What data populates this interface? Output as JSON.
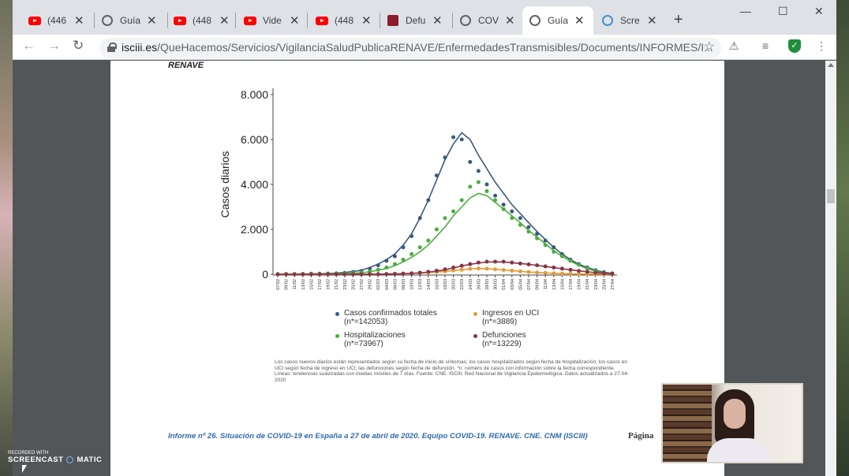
{
  "browser": {
    "tabs": [
      {
        "title": "(446",
        "icon": "youtube"
      },
      {
        "title": "Guía",
        "icon": "globe"
      },
      {
        "title": "(448",
        "icon": "youtube"
      },
      {
        "title": "Vide",
        "icon": "youtube"
      },
      {
        "title": "(448",
        "icon": "youtube"
      },
      {
        "title": "Defu",
        "icon": "defunciones"
      },
      {
        "title": "COVI",
        "icon": "globe"
      },
      {
        "title": "Guía",
        "icon": "globe"
      },
      {
        "title": "Scre",
        "icon": "screencast"
      }
    ],
    "active_tab_index": 7,
    "url_host": "isciii.es",
    "url_path": "/QueHacemos/Servicios/VigilanciaSaludPublicaRENAVE/EnfermedadesTransmisibles/Documents/INFORMES/I..."
  },
  "document": {
    "header_fragment": "RENAVE",
    "caption": "Los casos nuevos diarios están representados según su fecha de inicio de síntomas; los casos hospitalizados según fecha de hospitalización; los casos en UCI según fecha de ingreso en UCI; las defunciones según fecha de defunción. *n: número de casos con información sobre la fecha correspondiente. Líneas: tendencias suavizadas con medias móviles de 7 días. Fuente: CNE. ISCIII. Red Nacional de Vigilancia Epidemiológica. Datos actualizados a 27-04-2020",
    "footer": "Informe  nº 26.  Situación de COVID-19 en España a 27  de abril de 2020. Equipo COVID-19. RENAVE. CNE. CNM (ISCIII)",
    "page_label": "Página"
  },
  "chart_data": {
    "type": "scatter",
    "ylabel": "Casos diarios",
    "ylim": [
      0,
      8000
    ],
    "yticks": [
      "8.000",
      "6.000",
      "4.000",
      "2.000",
      "0"
    ],
    "yticks_values": [
      8000,
      6000,
      4000,
      2000,
      0
    ],
    "x_labels": [
      "07/02",
      "09/02",
      "11/02",
      "13/02",
      "15/02",
      "17/02",
      "19/02",
      "21/02",
      "23/02",
      "25/02",
      "27/02",
      "29/02",
      "02/03",
      "04/03",
      "06/03",
      "08/03",
      "10/03",
      "12/03",
      "14/03",
      "16/03",
      "18/03",
      "20/03",
      "22/03",
      "24/03",
      "26/03",
      "28/03",
      "30/03",
      "01/04",
      "03/04",
      "05/04",
      "07/04",
      "09/04",
      "11/04",
      "13/04",
      "15/04",
      "17/04",
      "19/04",
      "21/04",
      "23/04",
      "25/04",
      "27/04"
    ],
    "grid": false,
    "legend_position": "bottom",
    "series": [
      {
        "name": "Casos confirmados totales",
        "n_label": "(n*=142053)",
        "color": "#3b5a7f",
        "values": [
          5,
          10,
          10,
          15,
          20,
          25,
          30,
          40,
          60,
          100,
          150,
          250,
          400,
          600,
          800,
          1200,
          1700,
          2500,
          3300,
          4400,
          5200,
          6100,
          6000,
          5000,
          4600,
          4000,
          3500,
          3100,
          2800,
          2500,
          2100,
          1800,
          1500,
          1200,
          900,
          650,
          450,
          300,
          180,
          90,
          40
        ]
      },
      {
        "name": "Hospitalizaciones",
        "n_label": "(n*=73967)",
        "color": "#4aae3c",
        "values": [
          3,
          5,
          5,
          8,
          10,
          12,
          15,
          20,
          30,
          50,
          80,
          120,
          200,
          300,
          450,
          650,
          900,
          1200,
          1500,
          2000,
          2500,
          2800,
          3300,
          3900,
          4100,
          3700,
          3300,
          2900,
          2500,
          2200,
          1900,
          1600,
          1300,
          1000,
          800,
          600,
          420,
          260,
          140,
          60,
          20
        ]
      },
      {
        "name": "Ingresos en UCI",
        "n_label": "(n*=3889)",
        "color": "#e39b3b",
        "values": [
          0,
          0,
          0,
          0,
          0,
          0,
          0,
          0,
          0,
          2,
          4,
          6,
          10,
          15,
          20,
          30,
          45,
          60,
          80,
          100,
          130,
          170,
          200,
          240,
          260,
          250,
          220,
          190,
          160,
          130,
          100,
          80,
          60,
          40,
          30,
          20,
          12,
          8,
          4,
          2,
          0
        ]
      },
      {
        "name": "Defunciones",
        "n_label": "(n*=13229)",
        "color": "#8b3345",
        "values": [
          0,
          0,
          0,
          0,
          0,
          0,
          0,
          0,
          0,
          1,
          2,
          3,
          5,
          10,
          15,
          25,
          40,
          70,
          110,
          160,
          220,
          300,
          380,
          450,
          520,
          560,
          560,
          560,
          520,
          480,
          440,
          400,
          350,
          300,
          250,
          200,
          150,
          110,
          70,
          40,
          20
        ]
      }
    ],
    "trend_lines": [
      {
        "name": "Casos confirmados totales",
        "values": [
          3,
          5,
          8,
          12,
          18,
          25,
          35,
          50,
          80,
          120,
          180,
          300,
          450,
          650,
          900,
          1300,
          1800,
          2500,
          3300,
          4200,
          5100,
          5800,
          6300,
          6000,
          5300,
          4700,
          4100,
          3600,
          3100,
          2700,
          2300,
          1900,
          1550,
          1200,
          900,
          650,
          450,
          300,
          180,
          90,
          40
        ]
      },
      {
        "name": "Hospitalizaciones",
        "values": [
          2,
          3,
          4,
          6,
          8,
          10,
          14,
          20,
          30,
          45,
          70,
          110,
          180,
          260,
          380,
          550,
          750,
          1000,
          1300,
          1700,
          2100,
          2600,
          3000,
          3400,
          3600,
          3500,
          3200,
          2900,
          2600,
          2300,
          1950,
          1650,
          1350,
          1050,
          800,
          580,
          400,
          250,
          140,
          60,
          20
        ]
      },
      {
        "name": "Ingresos en UCI",
        "values": [
          0,
          0,
          0,
          0,
          0,
          0,
          0,
          0,
          1,
          2,
          3,
          5,
          8,
          12,
          18,
          27,
          40,
          55,
          75,
          100,
          130,
          165,
          200,
          235,
          255,
          245,
          220,
          190,
          160,
          130,
          100,
          80,
          60,
          42,
          30,
          20,
          12,
          8,
          4,
          2,
          0
        ]
      },
      {
        "name": "Defunciones",
        "values": [
          0,
          0,
          0,
          0,
          0,
          0,
          0,
          0,
          0,
          1,
          2,
          3,
          5,
          9,
          14,
          22,
          36,
          60,
          95,
          140,
          200,
          280,
          370,
          440,
          500,
          540,
          550,
          545,
          515,
          480,
          440,
          395,
          345,
          295,
          245,
          195,
          150,
          110,
          70,
          40,
          20
        ]
      }
    ]
  },
  "overlays": {
    "watermark_small": "RECORDED WITH",
    "watermark_brand_left": "SCREENCAST",
    "watermark_brand_right": "MATIC"
  }
}
